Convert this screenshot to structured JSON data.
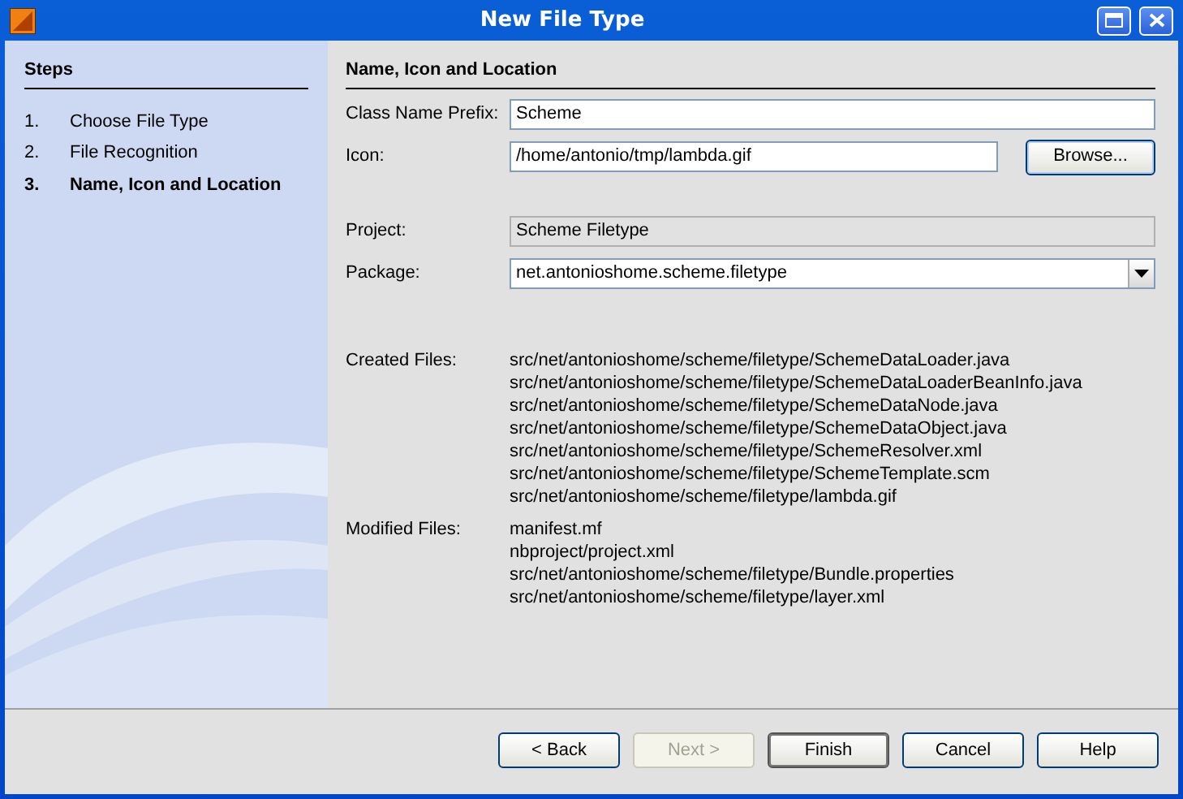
{
  "window": {
    "title": "New File Type"
  },
  "steps": {
    "heading": "Steps",
    "items": [
      {
        "number": "1.",
        "label": "Choose File Type",
        "selected": false
      },
      {
        "number": "2.",
        "label": "File Recognition",
        "selected": false
      },
      {
        "number": "3.",
        "label": "Name, Icon and Location",
        "selected": true
      }
    ]
  },
  "panel": {
    "heading": "Name, Icon and Location"
  },
  "fields": [
    {
      "kind": "text",
      "label": "Class Name Prefix:",
      "value": "Scheme",
      "disabled": false
    },
    {
      "kind": "browse",
      "label": "Icon:",
      "value": "/home/antonio/tmp/lambda.gif",
      "disabled": false,
      "button": "Browse..."
    },
    {
      "kind": "text",
      "label": "Project:",
      "value": "Scheme Filetype",
      "disabled": true
    },
    {
      "kind": "combo",
      "label": "Package:",
      "value": "net.antonioshome.scheme.filetype",
      "disabled": false
    }
  ],
  "file_groups": [
    {
      "label": "Created Files:",
      "files": [
        "src/net/antonioshome/scheme/filetype/SchemeDataLoader.java",
        "src/net/antonioshome/scheme/filetype/SchemeDataLoaderBeanInfo.java",
        "src/net/antonioshome/scheme/filetype/SchemeDataNode.java",
        "src/net/antonioshome/scheme/filetype/SchemeDataObject.java",
        "src/net/antonioshome/scheme/filetype/SchemeResolver.xml",
        "src/net/antonioshome/scheme/filetype/SchemeTemplate.scm",
        "src/net/antonioshome/scheme/filetype/lambda.gif"
      ]
    },
    {
      "label": "Modified Files:",
      "files": [
        "manifest.mf",
        "nbproject/project.xml",
        "src/net/antonioshome/scheme/filetype/Bundle.properties",
        "src/net/antonioshome/scheme/filetype/layer.xml"
      ]
    }
  ],
  "buttons": [
    {
      "label": "< Back",
      "disabled": false,
      "default": false
    },
    {
      "label": "Next >",
      "disabled": true,
      "default": false
    },
    {
      "label": "Finish",
      "disabled": false,
      "default": true
    },
    {
      "label": "Cancel",
      "disabled": false,
      "default": false
    },
    {
      "label": "Help",
      "disabled": false,
      "default": false
    }
  ]
}
